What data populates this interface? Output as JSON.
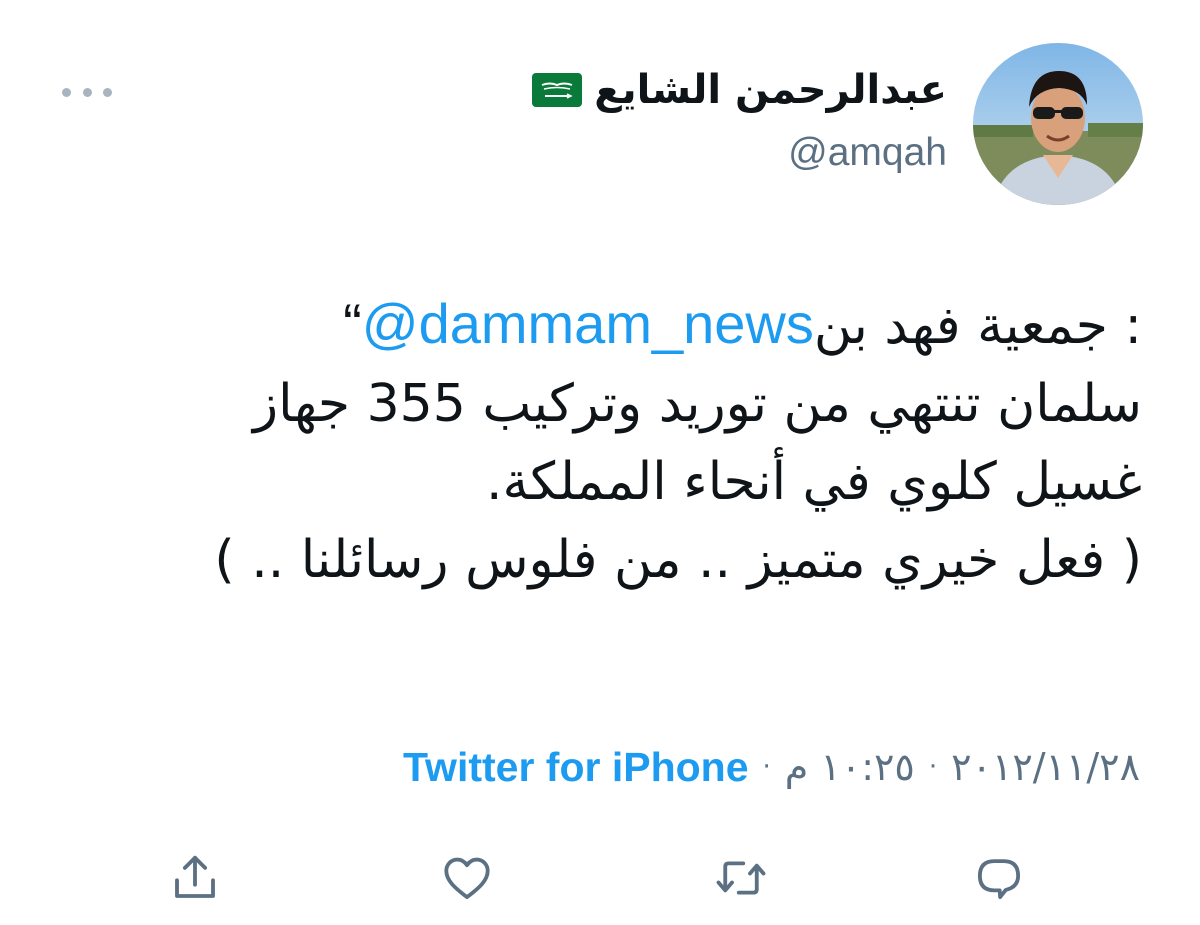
{
  "tweet": {
    "author_name": "عبدالرحمن الشايع",
    "handle": "@amqah",
    "flag_icon": "saudi-flag-icon",
    "open_quote": "“",
    "mention": "@dammam_news",
    "line1_rest": ": جمعية فهد بن",
    "line2": "سلمان تنتهي من توريد وتركيب 355 جهاز",
    "line3": "غسيل كلوي في أنحاء المملكة.",
    "line4": "( فعل خيري متميز .. من فلوس رسائلنا .. )"
  },
  "meta": {
    "source": "Twitter for iPhone",
    "separator": "·",
    "time": "١٠:٢٥ م",
    "date": "٢٠١٢/١١/٢٨"
  },
  "actions": {
    "reply_icon": "reply-icon",
    "retweet_icon": "retweet-icon",
    "like_icon": "heart-icon",
    "share_icon": "share-icon"
  },
  "colors": {
    "link": "#1d9bf0",
    "secondary": "#5b7083",
    "icon": "#5b7083"
  }
}
